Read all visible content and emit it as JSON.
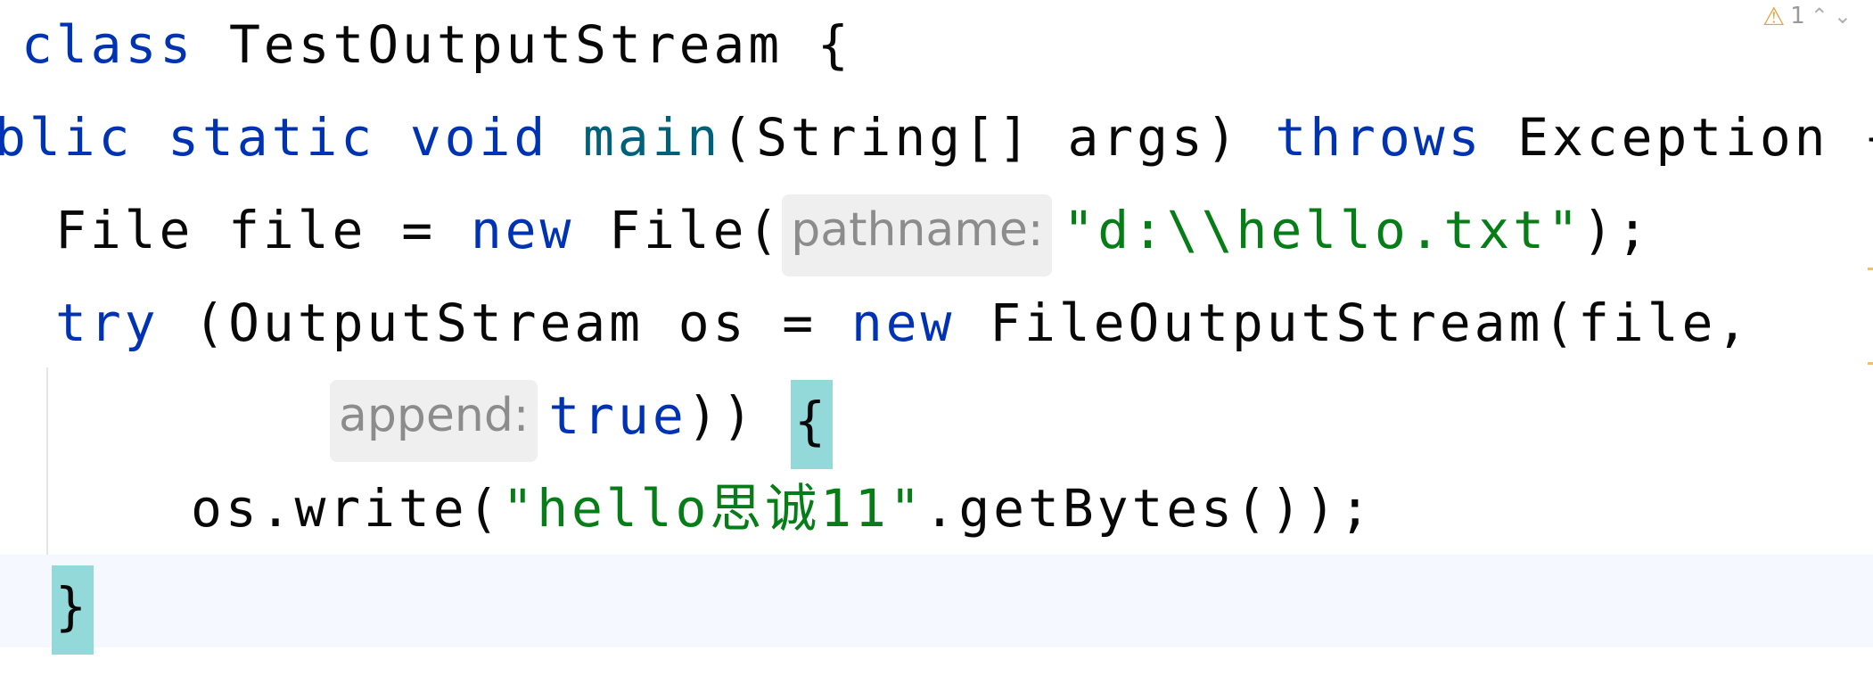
{
  "inspection": {
    "warning_icon": "warning-triangle-icon",
    "warning_glyph": "⚠",
    "warning_count": "1",
    "prev_glyph": "⌃",
    "next_glyph": "⌄"
  },
  "code": {
    "line1": {
      "kw": "class",
      "name": "TestOutputStream",
      "brace": "{"
    },
    "line2": {
      "kw1": "blic",
      "kw2": "static",
      "kw3": "void",
      "method": "main",
      "params": "(String[] args)",
      "kw4": "throws",
      "exc": "Exception",
      "brace": "{"
    },
    "line3": {
      "t1": "File file = ",
      "kw": "new",
      "t2": "File(",
      "hint": "pathname:",
      "str": "\"d:\\\\hello.txt\"",
      "t3": ");"
    },
    "line4": {
      "kw": "try",
      "t1": "(OutputStream os = ",
      "kw2": "new",
      "t2": "FileOutputStream(file,"
    },
    "line5": {
      "hint": "append:",
      "kw": "true",
      "t1": "))",
      "brace": "{"
    },
    "line6": {
      "t1": "os.write(",
      "str": "\"hello思诚11\"",
      "t2": ".getBytes());"
    },
    "line7": {
      "brace": "}"
    }
  }
}
